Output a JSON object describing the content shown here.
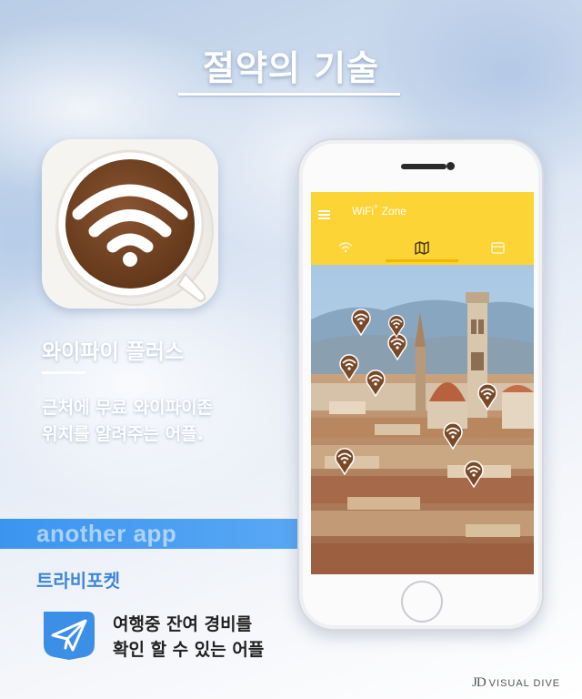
{
  "headline": "절약의 기술",
  "featured_app": {
    "icon": "wifi-coffee-cup-icon",
    "name": "와이파이 플러스",
    "description_lines": [
      "근처에 무료 와이파이존",
      "위치를 알려주는 어플."
    ]
  },
  "section_band": "another app",
  "other_app": {
    "name": "트라비포켓",
    "icon": "paper-plane-icon",
    "description_lines": [
      "여행중 잔여 경비를",
      "확인 할 수 있는 어플"
    ]
  },
  "phone_screen": {
    "app_title": "WiFi",
    "app_title_sup": "+",
    "app_title_suffix": " Zone",
    "tabs": [
      {
        "icon": "wifi-tab-icon",
        "active": false
      },
      {
        "icon": "map-tab-icon",
        "active": true
      },
      {
        "icon": "wallet-tab-icon",
        "active": false
      }
    ],
    "map_pin_count": 9,
    "colors": {
      "appbar": "#fdd435",
      "pin": "#7a4a28",
      "accent_band": "#3b95f0"
    }
  },
  "credit": {
    "logo": "JD",
    "text": "VISUAL DIVE"
  }
}
